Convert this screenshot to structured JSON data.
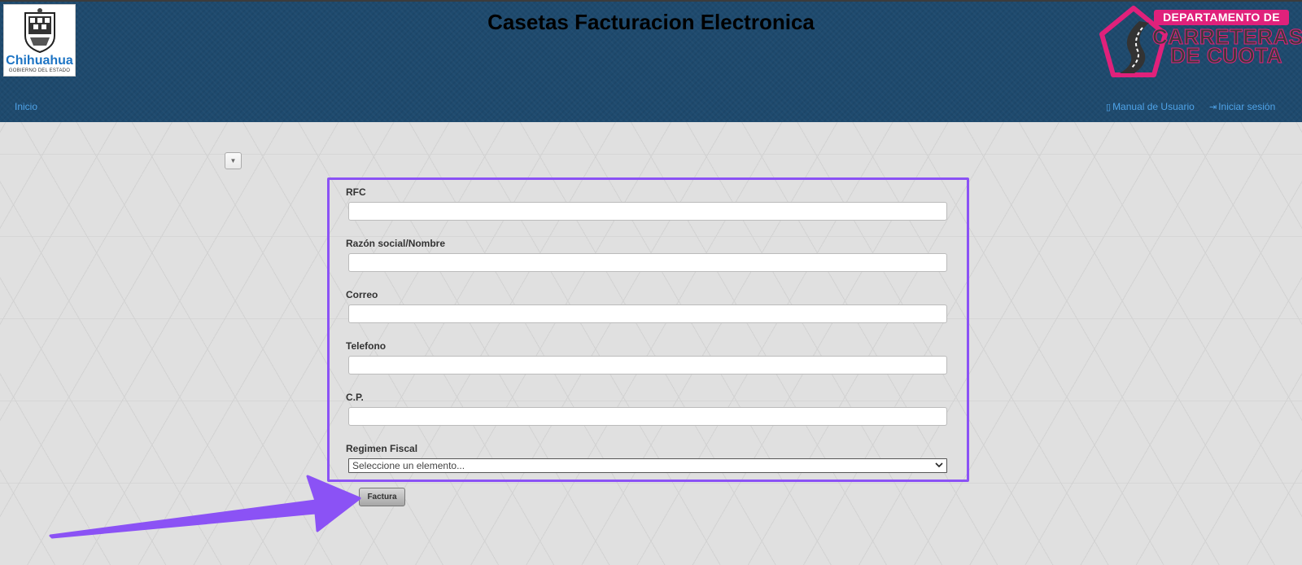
{
  "header": {
    "title": "Casetas Facturacion Electronica",
    "gov_logo": {
      "name": "Chihuahua",
      "sub": "GOBIERNO DEL ESTADO"
    },
    "dept_logo": {
      "line1": "DEPARTAMENTO DE",
      "line2": "CARRETERAS",
      "line3": "DE CUOTA"
    }
  },
  "nav": {
    "inicio": "Inicio",
    "manual": "Manual de Usuario",
    "login": "Iniciar sesión",
    "manual_icon": "book-icon",
    "login_icon": "sign-in-icon"
  },
  "collapse_toggle": {
    "glyph": "▼"
  },
  "form": {
    "fields": [
      {
        "label": "RFC",
        "value": "",
        "placeholder": ""
      },
      {
        "label": "Razón social/Nombre",
        "value": "",
        "placeholder": ""
      },
      {
        "label": "Correo",
        "value": "",
        "placeholder": ""
      },
      {
        "label": "Telefono",
        "value": "",
        "placeholder": ""
      },
      {
        "label": "C.P.",
        "value": "",
        "placeholder": ""
      }
    ],
    "regimen": {
      "label": "Regimen Fiscal",
      "selected": "Seleccione un elemento..."
    },
    "submit_label": "Factura"
  },
  "colors": {
    "header_bg": "#1e4a6e",
    "link": "#4fa3e8",
    "annotation": "#8b52f5",
    "brand_pink": "#e0217b",
    "gov_blue": "#1d74c4"
  }
}
